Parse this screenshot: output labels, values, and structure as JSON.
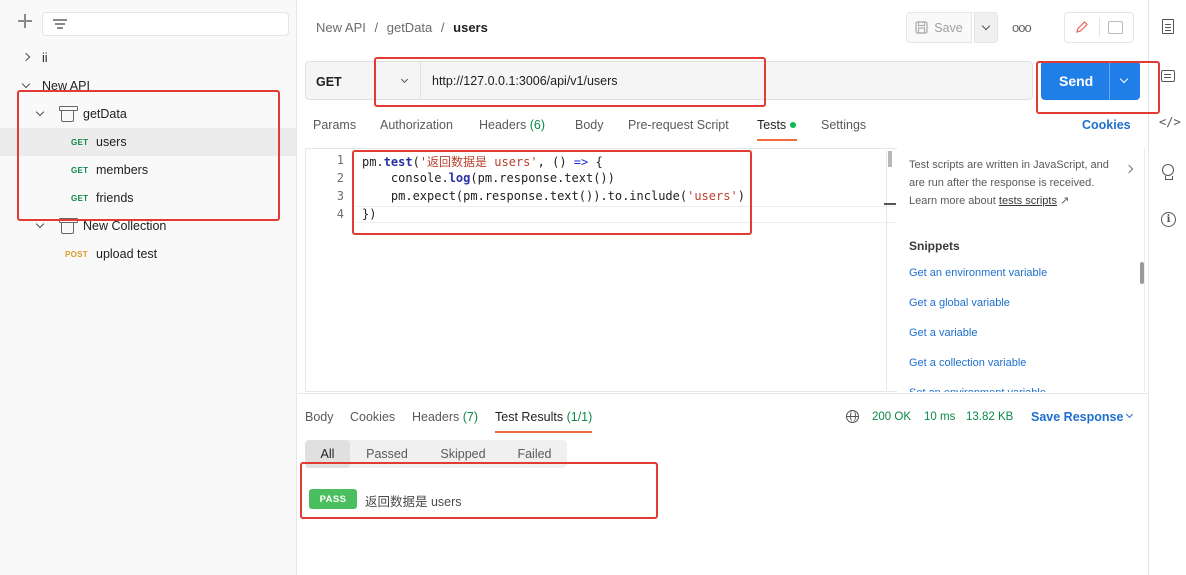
{
  "sidebar": {
    "tree": [
      {
        "label": "ii"
      },
      {
        "label": "New API"
      },
      {
        "label": "getData"
      },
      {
        "method": "GET",
        "label": "users"
      },
      {
        "method": "GET",
        "label": "members"
      },
      {
        "method": "GET",
        "label": "friends"
      },
      {
        "label": "New Collection"
      },
      {
        "method": "POST",
        "label": "upload test"
      }
    ]
  },
  "header": {
    "breadcrumb": [
      "New API",
      "getData",
      "users"
    ],
    "separator": "/",
    "save_label": "Save",
    "more_label": "ooo"
  },
  "request": {
    "method": "GET",
    "url": "http://127.0.0.1:3006/api/v1/users",
    "send_label": "Send",
    "tabs": [
      {
        "label": "Params"
      },
      {
        "label": "Authorization"
      },
      {
        "label": "Headers",
        "count": "(6)"
      },
      {
        "label": "Body"
      },
      {
        "label": "Pre-request Script"
      },
      {
        "label": "Tests"
      },
      {
        "label": "Settings"
      }
    ],
    "cookies_label": "Cookies"
  },
  "editor": {
    "line_numbers": [
      "1",
      "2",
      "3",
      "4"
    ],
    "lines": [
      {
        "a": "pm.",
        "b": "test",
        "c": "(",
        "d": "'返回数据是 users'",
        "e": ", () ",
        "f": "=>",
        "g": " {"
      },
      {
        "a": "    console.",
        "b": "log",
        "c": "(pm.response.text())"
      },
      {
        "a": "    pm.expect(pm.response.text()).to.include(",
        "b": "'users'",
        "c": ")"
      },
      {
        "a": "})"
      }
    ]
  },
  "side_panel": {
    "description": "Test scripts are written in JavaScript, and are run after the response is received. Learn more about",
    "link": "tests scripts",
    "link_arrow": "↗",
    "snippets_title": "Snippets",
    "snippets": [
      "Get an environment variable",
      "Get a global variable",
      "Get a variable",
      "Get a collection variable",
      "Set an environment variable"
    ]
  },
  "response": {
    "tabs": [
      {
        "label": "Body"
      },
      {
        "label": "Cookies"
      },
      {
        "label": "Headers",
        "count": "(7)"
      },
      {
        "label": "Test Results",
        "count": "(1/1)"
      }
    ],
    "status": "200 OK",
    "time": "10 ms",
    "size": "13.82 KB",
    "save_label": "Save Response",
    "filters": [
      "All",
      "Passed",
      "Skipped",
      "Failed"
    ],
    "results": [
      {
        "badge": "PASS",
        "name": "返回数据是 users"
      }
    ]
  },
  "rail": {
    "code_label": "</>",
    "info_label": "i"
  },
  "colors": {
    "accent": "#f26b3a",
    "send": "#1f7ee8",
    "pass": "#4bbf5f",
    "annotation": "#e23b34",
    "get": "#0a8a4a",
    "post": "#d89b28"
  }
}
